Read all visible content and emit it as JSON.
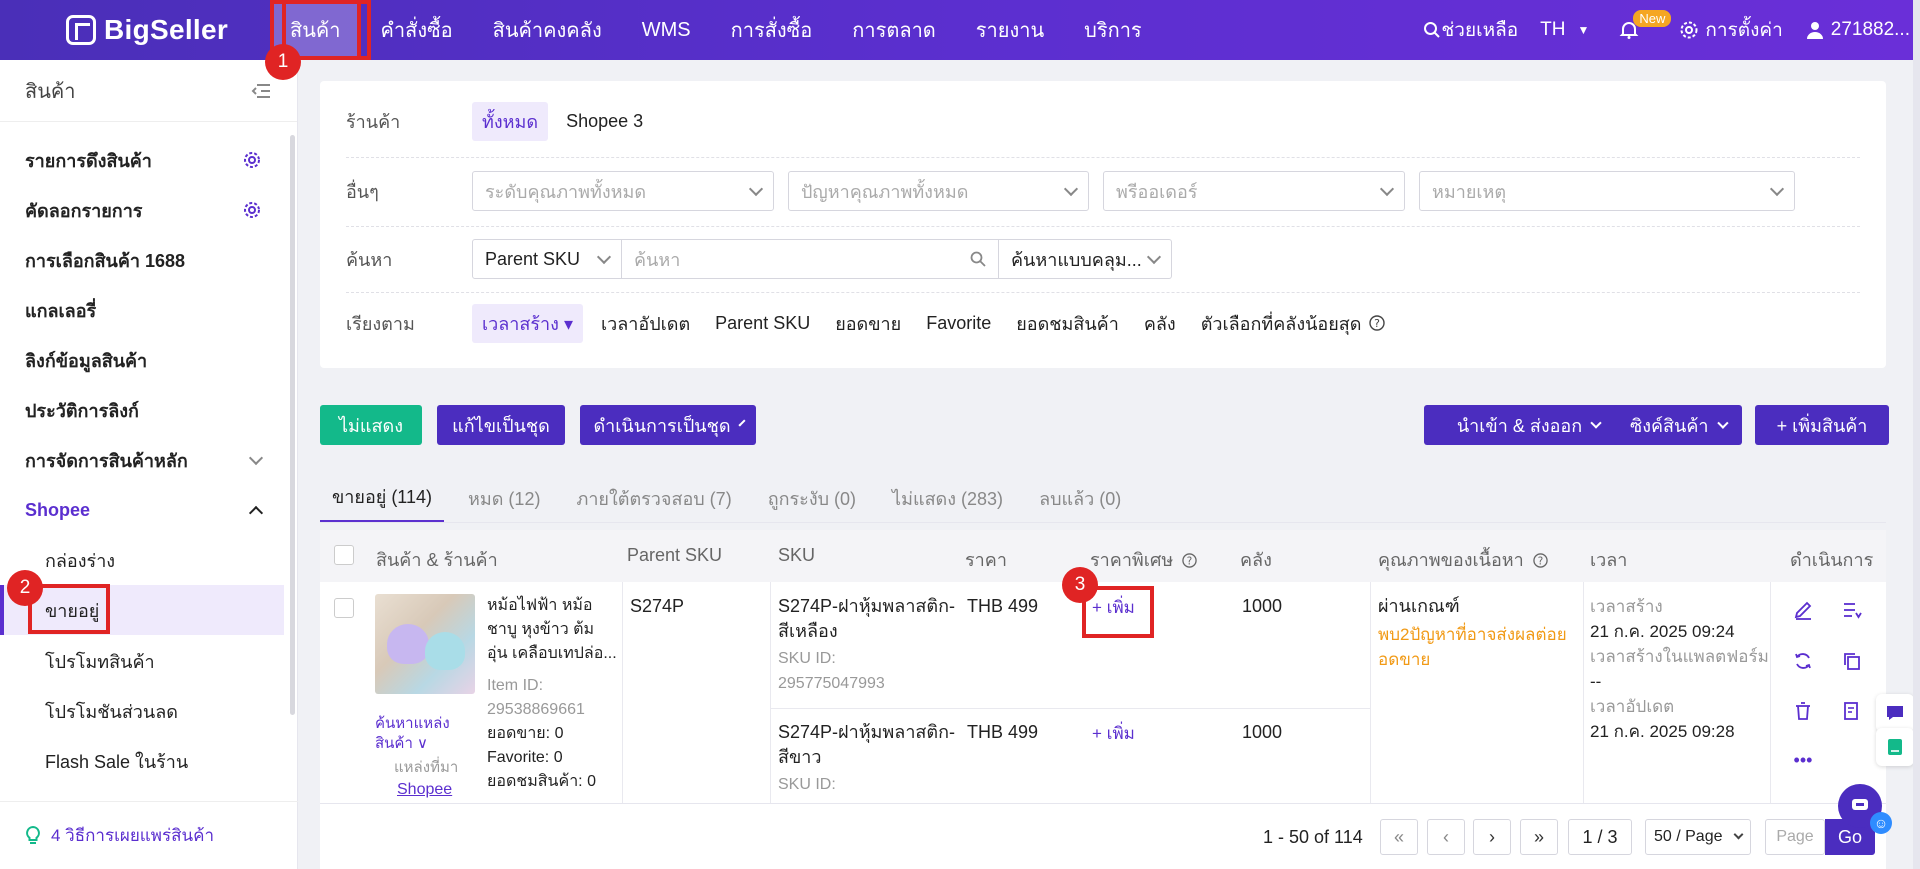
{
  "brand": {
    "name": "BigSeller"
  },
  "topnav": {
    "items": [
      "สินค้า",
      "คำสั่งซื้อ",
      "สินค้าคงคลัง",
      "WMS",
      "การสั่งซื้อ",
      "การตลาด",
      "รายงาน",
      "บริการ"
    ],
    "help": "ช่วยเหลือ",
    "lang": "TH",
    "new_badge": "New",
    "settings": "การตั้งค่า",
    "user": "271882..."
  },
  "sidebar": {
    "title": "สินค้า",
    "items": [
      "รายการดึงสินค้า",
      "คัดลอกรายการ",
      "การเลือกสินค้า 1688",
      "แกลเลอรี่",
      "ลิงก์ข้อมูลสินค้า",
      "ประวัติการลิงก์",
      "การจัดการสินค้าหลัก"
    ],
    "group": "Shopee",
    "sub": [
      "กล่องร่าง",
      "ขายอยู่",
      "โปรโมทสินค้า",
      "โปรโมชันส่วนลด",
      "Flash Sale ในร้าน"
    ],
    "footer": "4 วิธีการเผยแพร่สินค้า"
  },
  "filters": {
    "store_label": "ร้านค้า",
    "store_all": "ทั้งหมด",
    "store_name": "Shopee 3",
    "other_label": "อื่นๆ",
    "quality_placeholder": "ระดับคุณภาพทั้งหมด",
    "issue_placeholder": "ปัญหาคุณภาพทั้งหมด",
    "preorder_placeholder": "พรีออเดอร์",
    "note_placeholder": "หมายเหตุ",
    "search_label": "ค้นหา",
    "search_field": "Parent SKU",
    "search_placeholder": "ค้นหา",
    "search_mode": "ค้นหาแบบคลุม...",
    "sort_label": "เรียงตาม",
    "sort_active": "เวลาสร้าง ▾",
    "sort_items": [
      "เวลาอัปเดต",
      "Parent SKU",
      "ยอดขาย",
      "Favorite",
      "ยอดชมสินค้า",
      "คลัง",
      "ตัวเลือกที่คลังน้อยสุด"
    ]
  },
  "toolbar": {
    "hide": "ไม่แสดง",
    "batch_edit": "แก้ไขเป็นชุด",
    "batch_action": "ดำเนินการเป็นชุด",
    "import_export": "นำเข้า & ส่งออก",
    "sync": "ซิงค์สินค้า",
    "add_product": "+ เพิ่มสินค้า"
  },
  "tabs": [
    "ขายอยู่ (114)",
    "หมด (12)",
    "ภายใต้ตรวจสอบ (7)",
    "ถูกระงับ (0)",
    "ไม่แสดง (283)",
    "ลบแล้ว (0)"
  ],
  "table": {
    "headers": [
      "สินค้า & ร้านค้า",
      "Parent SKU",
      "SKU",
      "ราคา",
      "ราคาพิเศษ",
      "คลัง",
      "คุณภาพของเนื้อหา",
      "เวลา",
      "ดำเนินการ"
    ],
    "product": {
      "title_lines": [
        "หม้อไฟฟ้า หม้อ",
        "ชาบู หุงข้าว ต้ม",
        "อุ่น เคลือบเทปล่อ..."
      ],
      "item_id_label": "Item ID:",
      "item_id": "29538869661",
      "sales": "ยอดขาย: 0",
      "favorite": "Favorite: 0",
      "views": "ยอดชมสินค้า: 0",
      "source_link": "ค้นหาแหล่ง",
      "source_link2": "สินค้า",
      "source_label": "แหล่งที่มา",
      "source_value": "Shopee"
    },
    "parent_sku": "S274P",
    "variants": [
      {
        "sku_line1": "S274P-ฝาหุ้มพลาสติก-",
        "sku_line2": "สีเหลือง",
        "skuid_label": "SKU ID:",
        "skuid": "295775047993",
        "price": "THB 499",
        "special": "+ เพิ่ม",
        "stock": "1000"
      },
      {
        "sku_line1": "S274P-ฝาหุ้มพลาสติก-",
        "sku_line2": "สีขาว",
        "skuid_label": "SKU ID:",
        "skuid": "",
        "price": "THB 499",
        "special": "+ เพิ่ม",
        "stock": "1000"
      }
    ],
    "quality": "ผ่านเกณฑ์",
    "quality_warn1": "พบ2ปัญหาที่อาจส่งผลต่อย",
    "quality_warn2": "อดขาย",
    "time": {
      "created_label": "เวลาสร้าง",
      "created": "21 ก.ค. 2025 09:24",
      "platform_label": "เวลาสร้างในแพลตฟอร์ม",
      "platform": "--",
      "updated_label": "เวลาอัปเดต",
      "updated": "21 ก.ค. 2025 09:28"
    }
  },
  "pager": {
    "range": "1 - 50 of 114",
    "page": "1 / 3",
    "size": "50 / Page",
    "page_placeholder": "Page",
    "go": "Go"
  },
  "annotations": [
    "1",
    "2",
    "3"
  ],
  "colors": {
    "brand": "#5b2fcf",
    "highlight": "#e02424",
    "green": "#13b98a",
    "warning": "#f19a16"
  }
}
